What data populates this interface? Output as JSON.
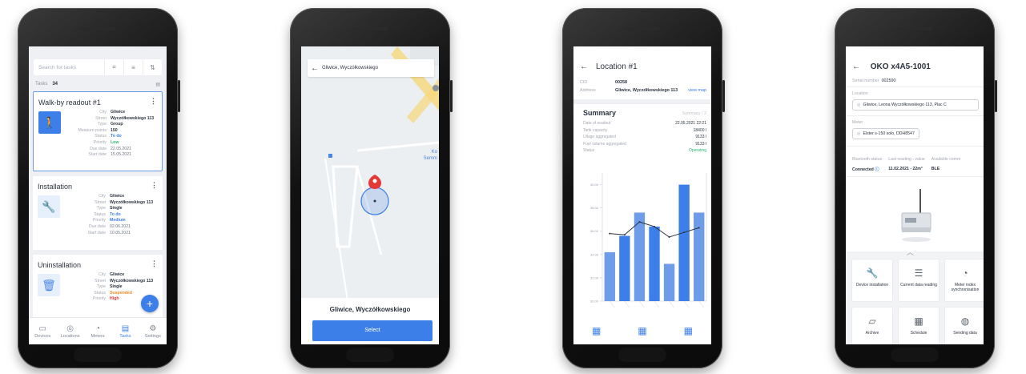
{
  "tasks_screen": {
    "search_placeholder": "Search for tasks",
    "tasks_label": "Tasks",
    "tasks_count": "34",
    "cards": [
      {
        "title": "Walk-by readout #1",
        "fields": [
          {
            "k": "City",
            "v": "Gliwice"
          },
          {
            "k": "Street",
            "v": "Wyczółkowskiego 113"
          },
          {
            "k": "Type",
            "v": "Group"
          },
          {
            "k": "Measure points",
            "v": "150"
          },
          {
            "k": "Status",
            "v": "To do"
          },
          {
            "k": "Priority",
            "v": "Low"
          },
          {
            "k": "Due date",
            "v": "22.05.2021"
          },
          {
            "k": "Start date",
            "v": "15.05.2021"
          }
        ]
      },
      {
        "title": "Installation",
        "fields": [
          {
            "k": "City",
            "v": "Gliwice"
          },
          {
            "k": "Street",
            "v": "Wyczółkowskiego 113"
          },
          {
            "k": "Type",
            "v": "Single"
          },
          {
            "k": "Status",
            "v": "To do"
          },
          {
            "k": "Priority",
            "v": "Medium"
          },
          {
            "k": "Due date",
            "v": "02.06.2021"
          },
          {
            "k": "Start date",
            "v": "10.05.2021"
          }
        ]
      },
      {
        "title": "Uninstallation",
        "fields": [
          {
            "k": "City",
            "v": "Gliwice"
          },
          {
            "k": "Street",
            "v": "Wyczółkowskiego 113"
          },
          {
            "k": "Type",
            "v": "Single"
          },
          {
            "k": "Status",
            "v": "Suspended"
          },
          {
            "k": "Priority",
            "v": "High"
          }
        ]
      }
    ],
    "fab": "+",
    "nav": [
      "Devices",
      "Locations",
      "Meters",
      "Tasks",
      "Settings"
    ],
    "colors": {
      "accent": "#3d7fe8",
      "todo": "#3d7fe8",
      "low": "#2bb673",
      "medium": "#3d7fe8",
      "suspended": "#f08a24",
      "high": "#e53935"
    }
  },
  "map_screen": {
    "search_text": "Gliwice, Wyczółkowskiego",
    "address": "Gliwice, Wyczółkowskiego",
    "select_label": "Select",
    "map_label_partial": "Ko Semm"
  },
  "location_screen": {
    "title": "Location #1",
    "cid_label": "CID",
    "cid_value": "00258",
    "address_label": "Address",
    "address_value": "Gliwice, Wyczółkowskiego 113",
    "view_map": "view map",
    "summary_title": "Summary",
    "summary_page": "Summary / 2",
    "rows": [
      {
        "k": "Date of readout",
        "v": "22.05.2021 22:21"
      },
      {
        "k": "Tank capacity",
        "v": "18400 l"
      },
      {
        "k": "Ullage aggregated",
        "v": "9133 l"
      },
      {
        "k": "Fuel volume aggregated",
        "v": "9133 l"
      },
      {
        "k": "Status",
        "v": "Operating"
      }
    ]
  },
  "chart_data": {
    "type": "bar",
    "title": "",
    "xlabel": "",
    "ylabel": "",
    "categories": [
      "",
      "",
      "",
      "",
      "",
      "",
      ""
    ],
    "series": [
      {
        "values": [
          34.2,
          35.6,
          37.6,
          36.4,
          33.2,
          40.0,
          37.6
        ],
        "kind": "bar"
      },
      {
        "values": [
          35.8,
          35.7,
          36.8,
          36.4,
          35.5,
          35.9,
          36.3
        ],
        "kind": "line"
      }
    ],
    "ylim": [
      30,
      41
    ],
    "yticks": [
      30,
      32,
      34,
      36,
      38,
      40
    ],
    "bar_color": "#3d7fe8",
    "bar_color_light": "#6f9ce8",
    "line_color": "#2d3440"
  },
  "device_screen": {
    "title": "OKO x4A5-1001",
    "serial_label": "Serial number",
    "serial_value": "002590",
    "location_label": "Location",
    "location_value": "Gliwice, Leona Wyczółkowskiego 113, Plac C",
    "meter_label": "Meter",
    "meter_value": "Elster s-150 solo, DDH8547",
    "bt_label": "Bluetooth status",
    "bt_value": "Connected",
    "last_label": "Last reading - value",
    "last_value": "11.02.2021 - 22m³",
    "avail_label": "Available comm",
    "avail_value": "BLE",
    "actions": [
      {
        "icon": "wrench-icon",
        "label": "Device installation"
      },
      {
        "icon": "document-icon",
        "label": "Current data reading"
      },
      {
        "icon": "gauge-icon",
        "label": "Meter index synchronisation"
      },
      {
        "icon": "archive-icon",
        "label": "Archive"
      },
      {
        "icon": "calendar-icon",
        "label": "Schedule"
      },
      {
        "icon": "globe-icon",
        "label": "Sending data"
      }
    ]
  }
}
